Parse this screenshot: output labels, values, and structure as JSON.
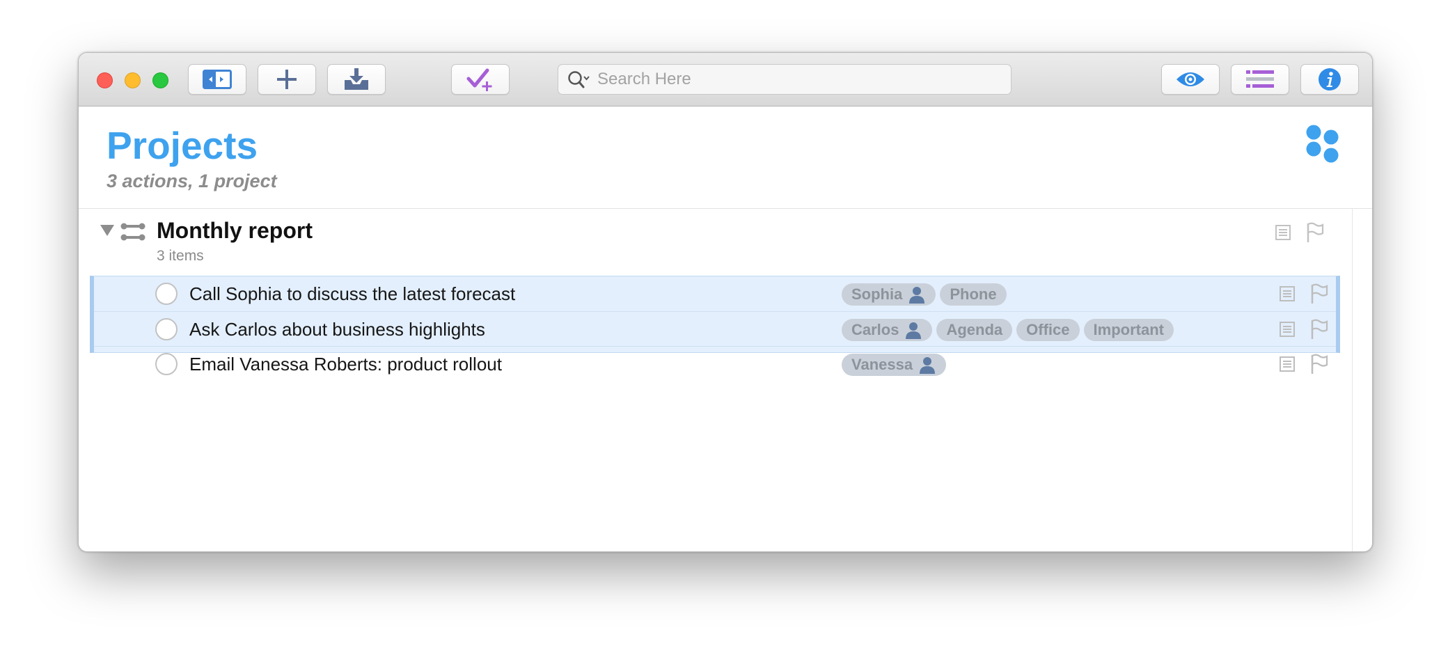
{
  "toolbar": {
    "buttons": [
      {
        "name": "sidebar-toggle-button",
        "icon": "sidebar-icon"
      },
      {
        "name": "new-item-button",
        "icon": "plus-icon"
      },
      {
        "name": "inbox-button",
        "icon": "inbox-tray-icon"
      },
      {
        "name": "quick-entry-button",
        "icon": "check-plus-icon"
      },
      {
        "name": "view-options-button",
        "icon": "eye-icon"
      },
      {
        "name": "outline-button",
        "icon": "list-icon"
      },
      {
        "name": "inspector-button",
        "icon": "info-icon"
      }
    ],
    "search": {
      "placeholder": "Search Here",
      "value": ""
    }
  },
  "header": {
    "title": "Projects",
    "subtitle": "3 actions, 1 project",
    "icon": "projects-perspective-icon"
  },
  "project": {
    "title": "Monthly report",
    "count": "3 items",
    "actions": [
      {
        "title": "Call Sophia to discuss the latest forecast",
        "tags": [
          {
            "label": "Sophia",
            "person": true
          },
          {
            "label": "Phone",
            "person": false
          }
        ]
      },
      {
        "title": "Ask Carlos about business highlights",
        "tags": [
          {
            "label": "Carlos",
            "person": true
          },
          {
            "label": "Agenda",
            "person": false
          },
          {
            "label": "Office",
            "person": false
          },
          {
            "label": "Important",
            "person": false
          }
        ]
      },
      {
        "title": "Email Vanessa Roberts: product rollout",
        "tags": [
          {
            "label": "Vanessa",
            "person": true
          }
        ]
      }
    ]
  },
  "colors": {
    "accent": "#3ea2ee",
    "selection": "#e3effd",
    "selection_edge": "#a8cbef",
    "tag_background": "#c9d0d9",
    "quick_entry": "#a65fd6"
  }
}
